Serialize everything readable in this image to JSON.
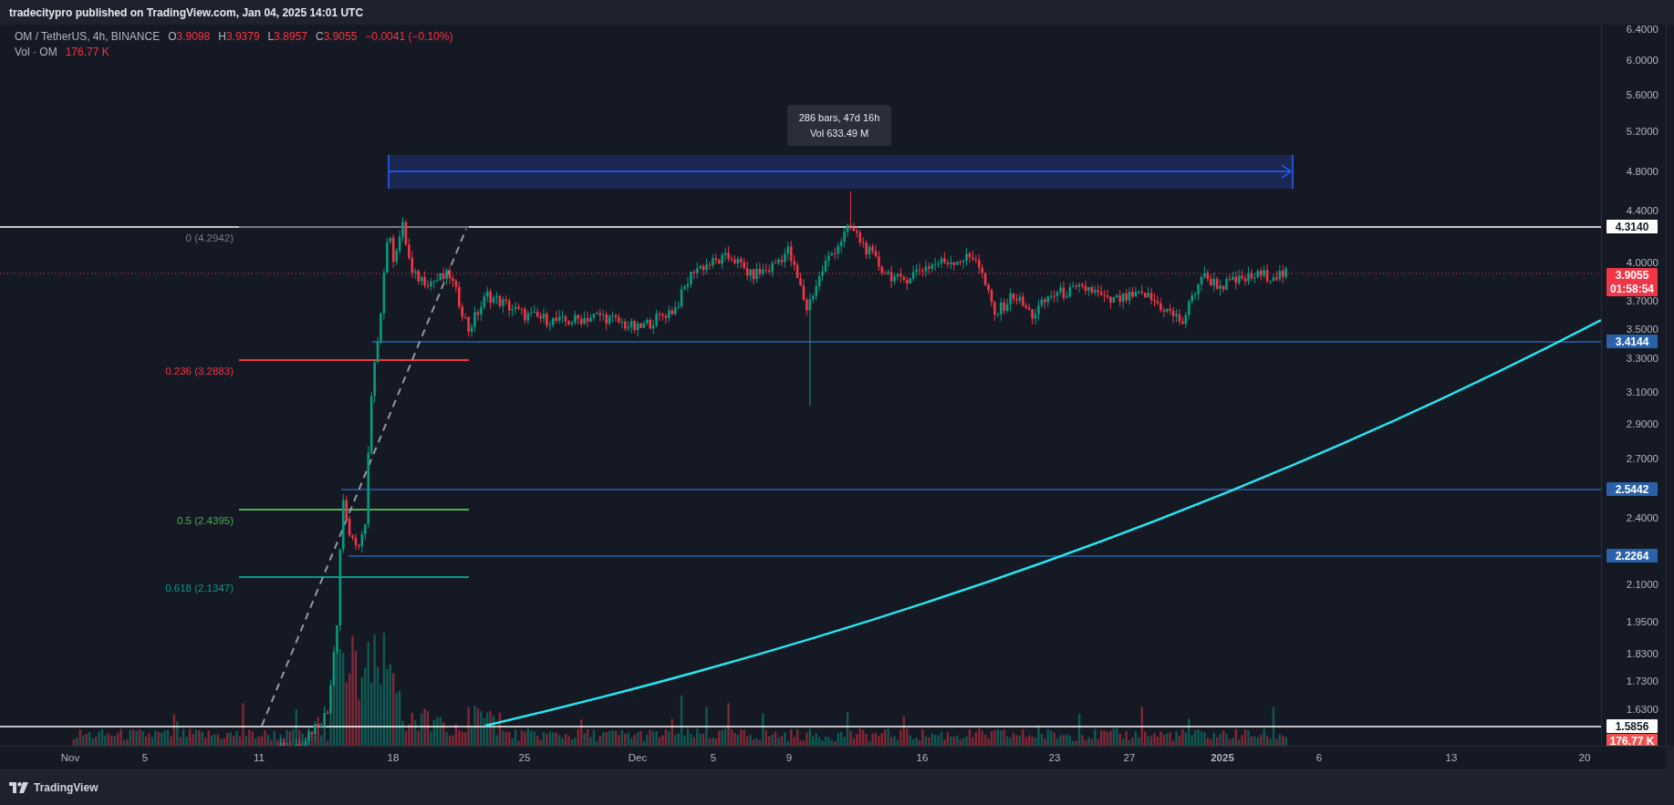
{
  "header": {
    "text": "tradecitypro published on TradingView.com, Jan 04, 2025 14:01 UTC"
  },
  "legend": {
    "symbol": "OM / TetherUS, 4h, BINANCE",
    "ohlc": [
      {
        "label": "O",
        "value": "3.9098"
      },
      {
        "label": "H",
        "value": "3.9379"
      },
      {
        "label": "L",
        "value": "3.8957"
      },
      {
        "label": "C",
        "value": "3.9055"
      }
    ],
    "change": "−0.0041 (−0.10%)",
    "volume_label": "Vol · OM",
    "volume_value": "176.77 K"
  },
  "measure": {
    "lines": [
      "286 bars, 47d 16h",
      "Vol 633.49 M"
    ]
  },
  "fib_levels": [
    {
      "label": "0 (4.2942)",
      "color": "#787b86"
    },
    {
      "label": "0.236 (3.2883)",
      "color": "#f23645"
    },
    {
      "label": "0.5 (2.4395)",
      "color": "#4caf50"
    },
    {
      "label": "0.618 (2.1347)",
      "color": "#089981"
    }
  ],
  "price_axis": {
    "ticks": [
      "6.4000",
      "6.0000",
      "5.6000",
      "5.2000",
      "4.8000",
      "4.4000",
      "4.0000",
      "3.7000",
      "3.5000",
      "3.3000",
      "3.1000",
      "2.9000",
      "2.7000",
      "2.4000",
      "2.1000",
      "1.9500",
      "1.8300",
      "1.7300",
      "1.6300"
    ],
    "tags": [
      {
        "kind": "level",
        "value": "4.3140",
        "color": "#ffffff"
      },
      {
        "kind": "price",
        "value": "3.9055",
        "countdown": "01:58:54",
        "color": "#f23645"
      },
      {
        "kind": "level",
        "value": "3.4144",
        "color": "#2962a8"
      },
      {
        "kind": "level",
        "value": "2.5442",
        "color": "#2962a8"
      },
      {
        "kind": "level",
        "value": "2.2264",
        "color": "#2962a8"
      },
      {
        "kind": "level",
        "value": "1.5856",
        "color": "#ffffff"
      },
      {
        "kind": "volume",
        "value": "176.77 K",
        "color": "#ef5350"
      }
    ]
  },
  "time_axis": [
    {
      "label": "Nov",
      "kind": "month"
    },
    {
      "label": "5",
      "kind": "day"
    },
    {
      "label": "11",
      "kind": "day"
    },
    {
      "label": "18",
      "kind": "day"
    },
    {
      "label": "25",
      "kind": "day"
    },
    {
      "label": "Dec",
      "kind": "month"
    },
    {
      "label": "5",
      "kind": "day"
    },
    {
      "label": "9",
      "kind": "day"
    },
    {
      "label": "16",
      "kind": "day"
    },
    {
      "label": "23",
      "kind": "day"
    },
    {
      "label": "27",
      "kind": "day"
    },
    {
      "label": "2025",
      "kind": "year"
    },
    {
      "label": "6",
      "kind": "day"
    },
    {
      "label": "13",
      "kind": "day"
    },
    {
      "label": "20",
      "kind": "day"
    }
  ],
  "footer": {
    "brand": "TradingView"
  }
}
